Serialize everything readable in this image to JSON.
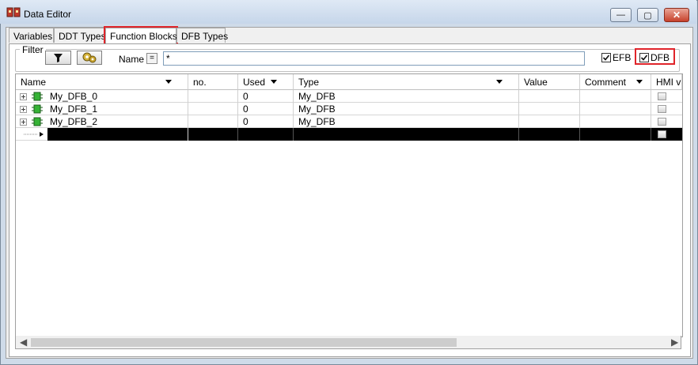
{
  "window": {
    "title": "Data Editor"
  },
  "tabs": [
    {
      "label": "Variables"
    },
    {
      "label": "DDT Types"
    },
    {
      "label": "Function Blocks"
    },
    {
      "label": "DFB Types"
    }
  ],
  "filter": {
    "legend": "Filter",
    "name_label": "Name",
    "eq_label": "=",
    "name_value": "*",
    "efb_label": "EFB",
    "efb_checked": true,
    "dfb_label": "DFB",
    "dfb_checked": true
  },
  "grid": {
    "columns": [
      {
        "label": "Name"
      },
      {
        "label": "no."
      },
      {
        "label": "Used"
      },
      {
        "label": "Type"
      },
      {
        "label": "Value"
      },
      {
        "label": "Comment"
      },
      {
        "label": "HMI va"
      }
    ],
    "rows": [
      {
        "name": "My_DFB_0",
        "no": "",
        "used": "0",
        "type": "My_DFB",
        "value": "",
        "comment": ""
      },
      {
        "name": "My_DFB_1",
        "no": "",
        "used": "0",
        "type": "My_DFB",
        "value": "",
        "comment": ""
      },
      {
        "name": "My_DFB_2",
        "no": "",
        "used": "0",
        "type": "My_DFB",
        "value": "",
        "comment": ""
      }
    ]
  },
  "colors": {
    "highlight": "#e0242a",
    "selection": "#000000"
  }
}
